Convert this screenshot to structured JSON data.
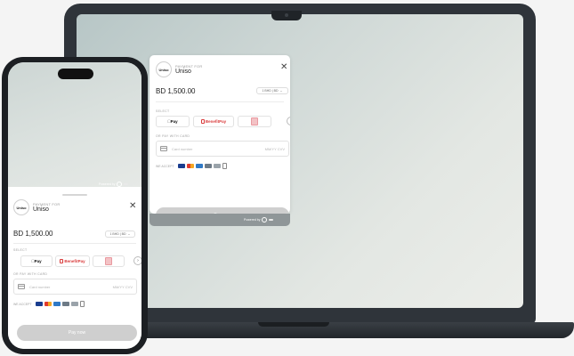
{
  "payment": {
    "payment_for_label": "PAYMENT FOR",
    "merchant_logo_text": "Uniso",
    "merchant_name": "Uniso",
    "amount": "BD 1,500.00",
    "currency_selector": "1 BHD | BD",
    "methods_label": "SELECT",
    "methods": [
      {
        "name": "Pay",
        "icon": "apple-pay-icon"
      },
      {
        "name": "BenefitPay",
        "icon": "benefit-pay-icon"
      },
      {
        "name": "",
        "icon": "card-wallet-icon"
      }
    ],
    "more_icon": "chevron-right-icon",
    "card_section_label": "OR PAY WITH CARD",
    "card_number_placeholder": "Card number",
    "card_expiry_cvv_placeholder": "MM/YY CVV",
    "we_accept_label": "WE ACCEPT",
    "accepted_brands": [
      "visa",
      "mastercard",
      "amex",
      "benefit",
      "generic",
      "other"
    ],
    "pay_button_label": "Pay now",
    "powered_by_label": "Powered by"
  },
  "colors": {
    "benefit_red": "#d93a3a",
    "pay_button_disabled": "#cfcfcf",
    "laptop_body": "#2f343a"
  }
}
